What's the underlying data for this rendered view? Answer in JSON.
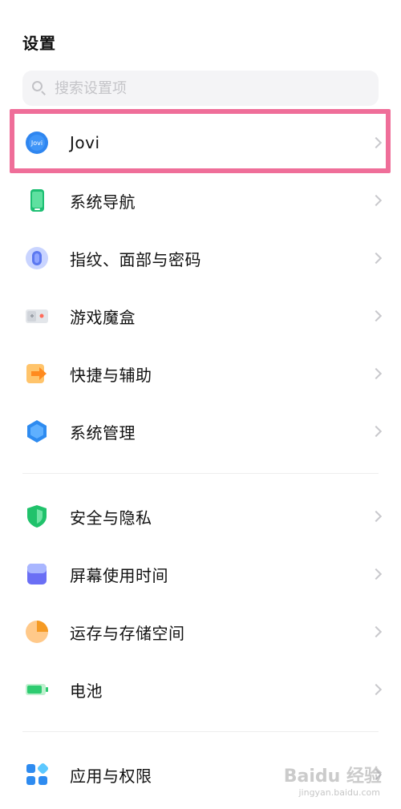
{
  "header": {
    "title": "设置"
  },
  "search": {
    "placeholder": "搜索设置项"
  },
  "items": [
    {
      "label": "Jovi",
      "icon": "jovi-icon"
    },
    {
      "label": "系统导航",
      "icon": "phone-navigation-icon"
    },
    {
      "label": "指纹、面部与密码",
      "icon": "fingerprint-icon"
    },
    {
      "label": "游戏魔盒",
      "icon": "game-box-icon"
    },
    {
      "label": "快捷与辅助",
      "icon": "shortcut-arrow-icon"
    },
    {
      "label": "系统管理",
      "icon": "system-management-icon"
    },
    {
      "label": "安全与隐私",
      "icon": "shield-icon"
    },
    {
      "label": "屏幕使用时间",
      "icon": "screen-time-icon"
    },
    {
      "label": "运存与存储空间",
      "icon": "storage-pie-icon"
    },
    {
      "label": "电池",
      "icon": "battery-icon"
    },
    {
      "label": "应用与权限",
      "icon": "apps-grid-icon"
    }
  ],
  "jovi_badge": "Jovi",
  "watermark": {
    "text": "Baidu 经验",
    "sub": "jingyan.baidu.com"
  },
  "colors": {
    "highlight": "#ef6e99",
    "jovi": "#2f86f0",
    "nav": "#1dbf73",
    "shield": "#20c26b",
    "shortcut": "#ff9a2e",
    "storage": "#f5a43b",
    "battery": "#2ecc71"
  }
}
